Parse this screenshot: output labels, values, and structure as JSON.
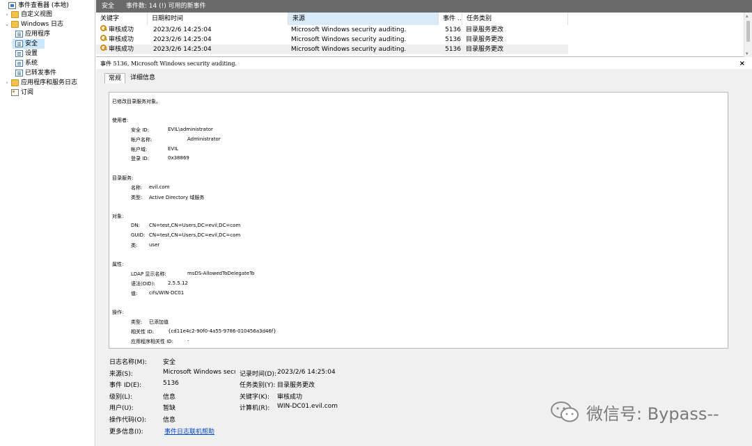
{
  "tree": {
    "root_label": "事件查看器 (本地)",
    "custom_views": "自定义视图",
    "windows_logs": "Windows 日志",
    "app_log": "应用程序",
    "security_log": "安全",
    "setup_log": "设置",
    "system_log": "系统",
    "forwarded_events": "已转发事件",
    "app_service_logs": "应用程序和服务日志",
    "subscriptions": "订阅"
  },
  "topbar": {
    "log_name": "安全",
    "event_count": "事件数: 14 (!) 可用的新事件"
  },
  "list": {
    "columns": [
      "关键字",
      "日期和时间",
      "来源",
      "事件 ...",
      "任务类别"
    ],
    "rows": [
      {
        "keyword": "审核成功",
        "datetime": "2023/2/6 14:25:04",
        "source": "Microsoft Windows security auditing.",
        "event_id": "5136",
        "task": "目录服务更改"
      },
      {
        "keyword": "审核成功",
        "datetime": "2023/2/6 14:25:04",
        "source": "Microsoft Windows security auditing.",
        "event_id": "5136",
        "task": "目录服务更改"
      },
      {
        "keyword": "审核成功",
        "datetime": "2023/2/6 14:25:04",
        "source": "Microsoft Windows security auditing.",
        "event_id": "5136",
        "task": "目录服务更改"
      }
    ]
  },
  "details": {
    "title": "事件 5136, Microsoft Windows security auditing.",
    "close": "×",
    "tab_general": "常规",
    "tab_details": "详细信息",
    "desc": {
      "intro": "已修改目录服务对象。",
      "subject_head": "使用者:",
      "security_id_label": "安全 ID:",
      "security_id_value": "EVIL\\administrator",
      "account_name_label": "帐户名称:",
      "account_name_value": "Administrator",
      "account_domain_label": "帐户域:",
      "account_domain_value": "EVIL",
      "logon_id_label": "登录 ID:",
      "logon_id_value": "0x38869",
      "dir_service_head": "目录服务:",
      "name_label": "名称:",
      "name_value": "evil.com",
      "type_label": "类型:",
      "type_value": "Active Directory 域服务",
      "object_head": "对象:",
      "dn_label": "DN:",
      "dn_value": "CN=test,CN=Users,DC=evil,DC=com",
      "guid_label": "GUID:",
      "guid_value": "CN=test,CN=Users,DC=evil,DC=com",
      "class_label": "类:",
      "class_value": "user",
      "attr_head": "属性:",
      "ldap_label": "LDAP 显示名称:",
      "ldap_value": "msDS-AllowedToDelegateTo",
      "syntax_label": "语法(OID):",
      "syntax_value": "2.5.5.12",
      "value_label": "值:",
      "value_value": "cifs/WIN-DC01",
      "op_head": "操作:",
      "op_type_label": "类型:",
      "op_type_value": "已添加值",
      "corr_label": "相关性 ID:",
      "corr_value": "{cd11e4c2-90f0-4a55-9786-010456a3d46f}",
      "app_corr_label": "应用程序相关性 ID:",
      "app_corr_value": "-"
    },
    "props": {
      "log_name_label": "日志名称(M):",
      "log_name_value": "安全",
      "source_label": "来源(S):",
      "source_value": "Microsoft Windows secur",
      "logged_label": "记录时间(D):",
      "logged_value": "2023/2/6 14:25:04",
      "event_id_label": "事件 ID(E):",
      "event_id_value": "5136",
      "task_label": "任务类别(Y):",
      "task_value": "目录服务更改",
      "level_label": "级别(L):",
      "level_value": "信息",
      "keywords_label": "关键字(K):",
      "keywords_value": "审核成功",
      "user_label": "用户(U):",
      "user_value": "暂缺",
      "computer_label": "计算机(R):",
      "computer_value": "WIN-DC01.evil.com",
      "opcode_label": "操作代码(O):",
      "opcode_value": "信息",
      "more_info_label": "更多信息(I):",
      "more_info_link": "事件日志联机帮助"
    }
  },
  "watermark": {
    "text": "微信号: Bypass--"
  }
}
